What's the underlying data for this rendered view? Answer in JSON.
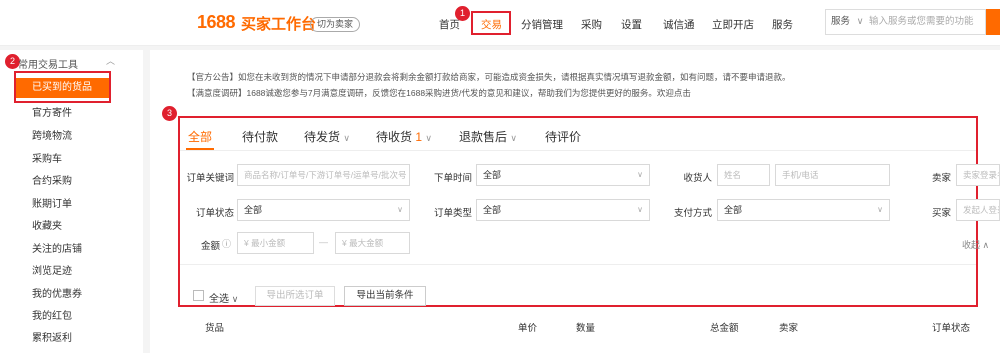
{
  "header": {
    "logo_number": "1688",
    "logo_text": "买家工作台",
    "switch_label": "切为卖家",
    "nav": [
      "首页",
      "交易",
      "分销管理",
      "采购",
      "设置",
      "诚信通",
      "立即开店",
      "服务"
    ],
    "search_type": "服务",
    "search_placeholder": "输入服务或您需要的功能"
  },
  "annotations": {
    "badge1": "1",
    "badge2": "2",
    "badge3": "3"
  },
  "sidebar": {
    "title": "常用交易工具",
    "active": "已买到的货品",
    "items": [
      "官方寄件",
      "跨境物流",
      "采购车",
      "合约采购",
      "账期订单",
      "收藏夹",
      "关注的店铺",
      "浏览足迹",
      "我的优惠券",
      "我的红包",
      "累积返利"
    ]
  },
  "notices": {
    "line1": "【官方公告】如您在未收到货的情况下申请部分退款会将剩余金额打款给商家，可能造成资金损失，请根据真实情况填写退款金额，如有问题，请不要申请退款。",
    "line2": "【满意度调研】1688诚邀您参与7月满意度调研，反馈您在1688采购进货/代发的意见和建议，帮助我们为您提供更好的服务。欢迎点击"
  },
  "tabs": [
    {
      "label": "全部"
    },
    {
      "label": "待付款"
    },
    {
      "label": "待发货"
    },
    {
      "label": "待收货",
      "count": "1"
    },
    {
      "label": "退款售后"
    },
    {
      "label": "待评价"
    }
  ],
  "filters": {
    "order_keyword_label": "订单关键词",
    "order_keyword_placeholder": "商品名称/订单号/下游订单号/运单号/批次号",
    "order_time_label": "下单时间",
    "order_time_value": "全部",
    "receiver_label": "收货人",
    "receiver_name_placeholder": "姓名",
    "receiver_phone_placeholder": "手机/电话",
    "seller_label": "卖家",
    "seller_placeholder": "卖家登录名",
    "order_status_label": "订单状态",
    "order_status_value": "全部",
    "order_type_label": "订单类型",
    "order_type_value": "全部",
    "payment_label": "支付方式",
    "payment_value": "全部",
    "seller2_label": "买家",
    "seller2_placeholder": "发起人登录名",
    "amount_label": "金额",
    "amount_min_placeholder": "¥  最小金额",
    "amount_sep": "—",
    "amount_max_placeholder": "¥  最大金额",
    "collapse_label": "收起"
  },
  "actions": {
    "select_all": "全选",
    "export_selected": "导出所选订单",
    "export_current": "导出当前条件"
  },
  "table_headers": [
    "货品",
    "单价",
    "数量",
    "总金额",
    "卖家",
    "订单状态"
  ],
  "colors": {
    "accent": "#ff6a00",
    "annotation": "#e0202e"
  }
}
